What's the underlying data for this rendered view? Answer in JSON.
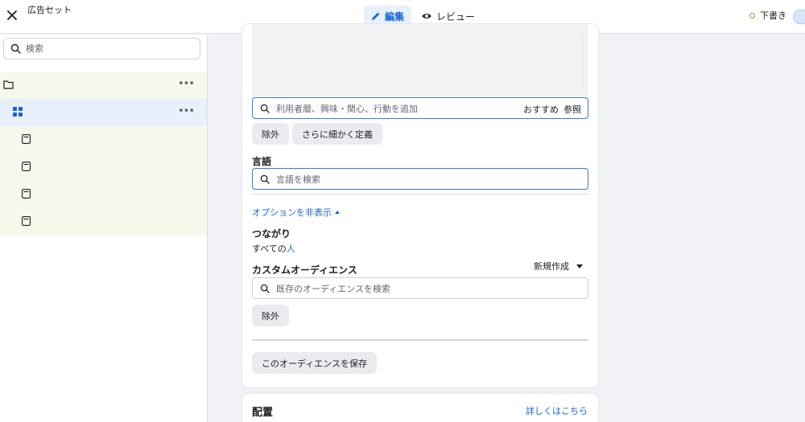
{
  "header": {
    "title": "広告セット",
    "tabs": [
      {
        "label": "編集",
        "icon": "pencil-icon",
        "active": true
      },
      {
        "label": "レビュー",
        "icon": "eye-icon",
        "active": false
      }
    ],
    "status": "下書き"
  },
  "sidebar": {
    "search_placeholder": "検索",
    "items": [
      {
        "type": "campaign",
        "icon": "folder-icon"
      },
      {
        "type": "ad-set",
        "icon": "grid-icon",
        "selected": true
      },
      {
        "type": "ad",
        "icon": "ad-icon"
      },
      {
        "type": "ad",
        "icon": "ad-icon"
      },
      {
        "type": "ad",
        "icon": "ad-icon"
      },
      {
        "type": "ad",
        "icon": "ad-icon"
      }
    ]
  },
  "targeting": {
    "detailed_placeholder": "利用者層、興味・関心、行動を追加",
    "suggest_label": "おすすめ",
    "browse_label": "参照",
    "exclude_label": "除外",
    "narrow_label": "さらに細かく定義"
  },
  "language": {
    "label": "言語",
    "placeholder": "言語を検索"
  },
  "options": {
    "toggle_label": "オプションを非表示"
  },
  "connections": {
    "label": "つながり",
    "value_prefix": "すべての",
    "value_link": "人"
  },
  "custom_audience": {
    "label": "カスタムオーディエンス",
    "new_label": "新規作成",
    "placeholder": "既存のオーディエンスを検索",
    "exclude_label": "除外",
    "save_label": "このオーディエンスを保存"
  },
  "placement": {
    "label": "配置",
    "learn_more": "詳しくはこちら"
  },
  "colors": {
    "accent": "#1664d6",
    "focus_border": "#3a78e0",
    "tree_bg": "#f5f9ec",
    "tree_selected_bg": "#e8f0fc",
    "draft_dot": "#6bab3a"
  }
}
